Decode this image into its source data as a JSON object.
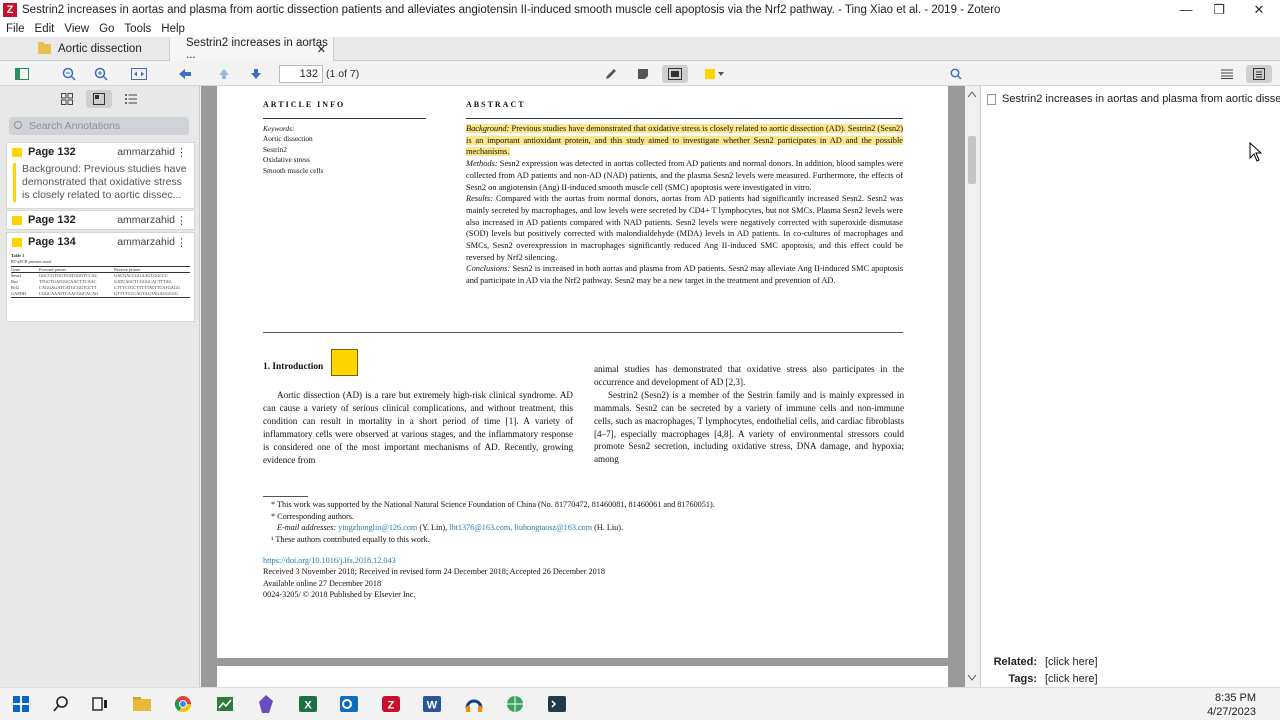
{
  "window": {
    "title": "Sestrin2 increases in aortas and plasma from aortic dissection patients and alleviates angiotensin II-induced smooth muscle cell apoptosis via the Nrf2 pathway. - Ting Xiao et al. - 2019 - Zotero",
    "logo": "Z",
    "minimize": "—",
    "maximize": "❐",
    "close": "✕"
  },
  "menu": [
    "File",
    "Edit",
    "View",
    "Go",
    "Tools",
    "Help"
  ],
  "tabs": [
    {
      "label": "Aortic dissection"
    },
    {
      "label": "Sestrin2 increases in aortas ..."
    }
  ],
  "tab_close": "✕",
  "toolbar": {
    "page_value": "132",
    "page_count": "(1 of 7)",
    "highlight_color": "#ffd400"
  },
  "sidebar": {
    "search_placeholder": "Search Annotations",
    "annotations": [
      {
        "page": "Page 132",
        "author": "ammarzahid",
        "text": "Background: Previous studies have demonstrated that oxidative stress is closely related to aortic dissec..."
      },
      {
        "page": "Page 132",
        "author": "ammarzahid",
        "text": ""
      },
      {
        "page": "Page 134",
        "author": "ammarzahid",
        "text": ""
      }
    ],
    "table_thumb": {
      "title": "Table 1",
      "subtitle": "RT-qPCR primers used.",
      "headers": [
        "Gene",
        "Forward primer",
        "Reverse primer"
      ],
      "rows": [
        [
          "Sesn2",
          "GGCCGTGGTGATGGGTCCAC",
          "GACGACCGGAAGTGGCCC"
        ],
        [
          "Bax",
          "TTGCTGATGGCAACTTCAAC",
          "GATCAGCTCGGGCACTTTAG"
        ],
        [
          "Bcl2",
          "CAGGAGATCATGCGGTCCTT",
          "CTTTCTGCTTTTTATTTCATGAGG"
        ],
        [
          "GAPDH",
          "CGGCAAATTCAACGGCACAG",
          "GTTTTCCCAGTAGTAGAGGCGG"
        ]
      ]
    }
  },
  "article": {
    "info_heading": "ARTICLE INFO",
    "abstract_heading": "ABSTRACT",
    "keywords_label": "Keywords:",
    "keywords": [
      "Aortic dissection",
      "Sestrin2",
      "Oxidative stress",
      "Smooth muscle cells"
    ],
    "background_label": "Background:",
    "background": "Previous studies have demonstrated that oxidative stress is closely related to aortic dissection (AD). Sestrin2 (Sesn2) is an important antioxidant protein, and this study aimed to investigate whether Sesn2 participates in AD and the possible mechanisms.",
    "methods_label": "Methods:",
    "methods": "Sesn2 expression was detected in aortas collected from AD patients and normal donors. In addition, blood samples were collected from AD patients and non-AD (NAD) patients, and the plasma Sesn2 levels were measured. Furthermore, the effects of Sesn2 on angiotensin (Ang) II-induced smooth muscle cell (SMC) apoptosis were investigated in vitro.",
    "results_label": "Results:",
    "results": "Compared with the aortas from normal donors, aortas from AD patients had significantly increased Sesn2. Sesn2 was mainly secreted by macrophages, and low levels were secreted by CD4+ T lymphocytes, but not SMCs. Plasma Sesn2 levels were also increased in AD patients compared with NAD patients. Sesn2 levels were negatively corrected with superoxide dismutase (SOD) levels but positively corrected with malondialdehyde (MDA) levels in AD patients. In co-cultures of macrophages and SMCs, Sesn2 overexpression in macrophages significantly reduced Ang II-induced SMC apoptosis, and this effect could be reversed by Nrf2 silencing.",
    "conclusions_label": "Conclusions:",
    "conclusions": "Sesn2 is increased in both aortas and plasma from AD patients. Sesn2 may alleviate Ang II-induced SMC apoptosis and participate in AD via the Nrf2 pathway. Sesn2 may be a new target in the treatment and prevention of AD.",
    "intro_heading": "1.  Introduction",
    "intro_left": "Aortic dissection (AD) is a rare but extremely high-risk clinical syndrome. AD can cause a variety of serious clinical complications, and without treatment, this condition can result in mortality in a short period of time [1]. A variety of inflammatory cells were observed at various stages, and the inflammatory response is considered one of the most important mechanisms of AD. Recently, growing evidence from",
    "intro_right_1": "animal studies has demonstrated that oxidative stress also participates in the occurrence and development of AD [2,3].",
    "intro_right_2": "Sestrin2 (Sesn2) is a member of the Sestrin family and is mainly expressed in mammals. Sesn2 can be secreted by a variety of immune cells and non-immune cells, such as macrophages, T lymphocytes, endothelial cells, and cardiac fibroblasts [4–7], especially macrophages [4,8]. A variety of environmental stressors could promote Sesn2 secretion, including oxidative stress, DNA damage, and hypoxia; among",
    "footnote_1": "* This work was supported by the National Natural Science Foundation of China (No. 81770472, 81460081, 81460061 and 81760051).",
    "footnote_2": "* Corresponding authors.",
    "email_label": "E-mail addresses:",
    "email_1": "yingzhonglin@126.com",
    "email_1_name": "(Y. Lin),",
    "email_2": "lbt1376@163.com,",
    "email_3": "liuhongtaosz@163.com",
    "email_3_name": "(H. Liu).",
    "footnote_3": "¹ These authors contributed equally to this work.",
    "doi": "https://doi.org/10.1016/j.lfs.2018.12.043",
    "received": "Received 3 November 2018; Received in revised form 24 December 2018; Accepted 26 December 2018",
    "available": "Available online 27 December 2018",
    "copyright": "0024-3205/ © 2018 Published by Elsevier Inc."
  },
  "right_pane": {
    "item": "Sestrin2 increases in aortas and plasma from aortic dissectio...",
    "related_label": "Related:",
    "related_value": "[click here]",
    "tags_label": "Tags:",
    "tags_value": "[click here]"
  },
  "taskbar": {
    "time": "8:35 PM",
    "date": "4/27/2023"
  }
}
